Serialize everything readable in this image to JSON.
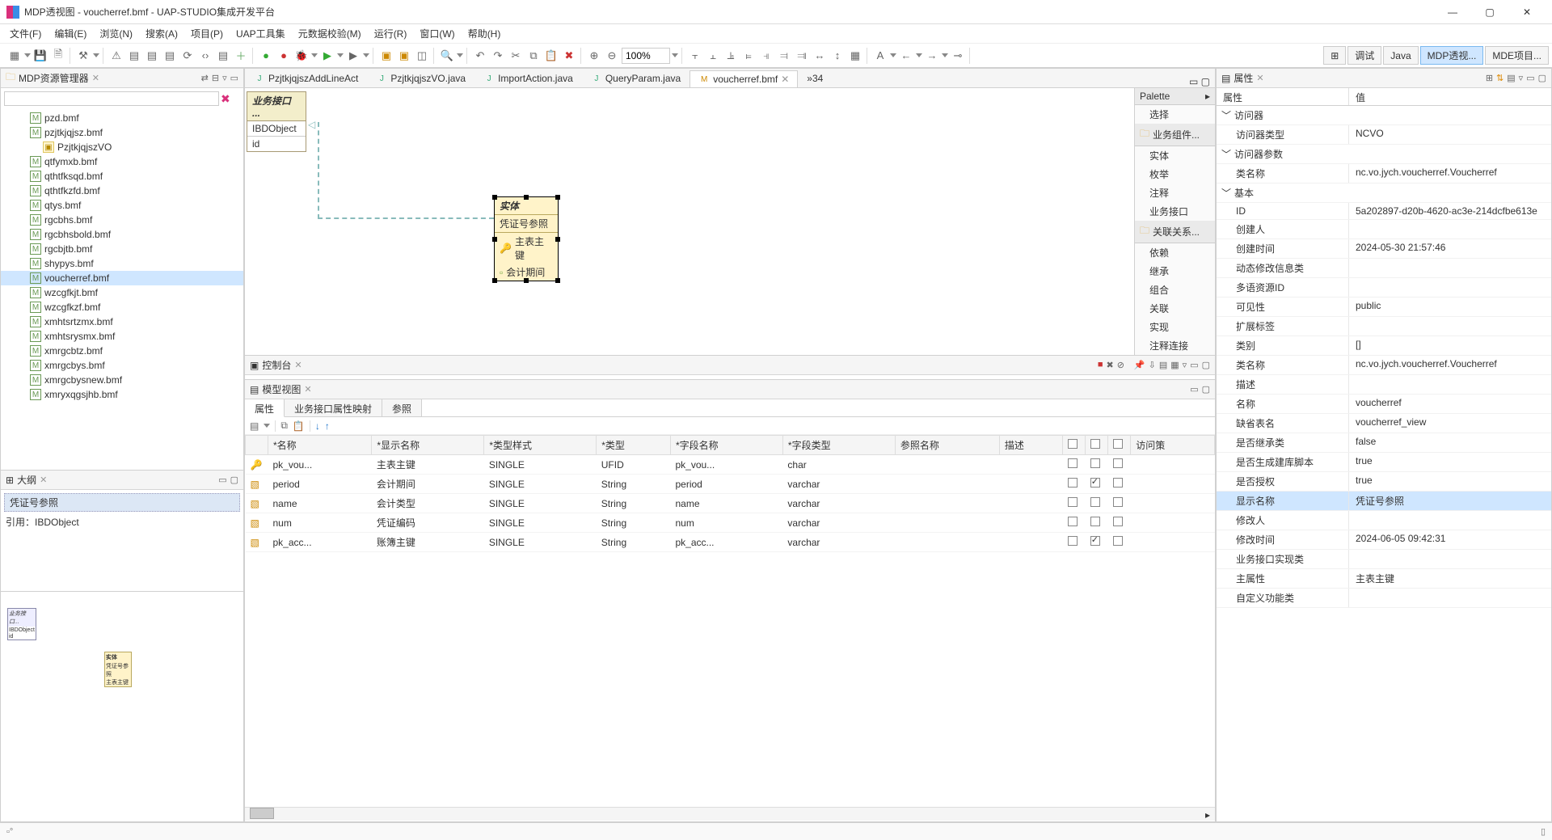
{
  "window": {
    "title": "MDP透视图 -  voucherref.bmf  -  UAP-STUDIO集成开发平台",
    "minimize": "—",
    "maximize": "▢",
    "close": "✕"
  },
  "menubar": [
    "文件(F)",
    "编辑(E)",
    "浏览(N)",
    "搜索(A)",
    "项目(P)",
    "UAP工具集",
    "元数据校验(M)",
    "运行(R)",
    "窗口(W)",
    "帮助(H)"
  ],
  "zoom": "100%",
  "perspectives": [
    {
      "label": "调试",
      "active": false
    },
    {
      "label": "Java",
      "active": false
    },
    {
      "label": "MDP透视...",
      "active": true
    },
    {
      "label": "MDE项目...",
      "active": false
    }
  ],
  "explorer": {
    "title": "MDP资源管理器",
    "items": [
      {
        "label": "pzd.bmf",
        "type": "m"
      },
      {
        "label": "pzjtkjqjsz.bmf",
        "type": "m"
      },
      {
        "label": "PzjtkjqjszVO",
        "type": "y",
        "indent": true
      },
      {
        "label": "qtfymxb.bmf",
        "type": "m"
      },
      {
        "label": "qthtfksqd.bmf",
        "type": "m"
      },
      {
        "label": "qthtfkzfd.bmf",
        "type": "m"
      },
      {
        "label": "qtys.bmf",
        "type": "m"
      },
      {
        "label": "rgcbhs.bmf",
        "type": "m"
      },
      {
        "label": "rgcbhsbold.bmf",
        "type": "m"
      },
      {
        "label": "rgcbjtb.bmf",
        "type": "m"
      },
      {
        "label": "shypys.bmf",
        "type": "m"
      },
      {
        "label": "voucherref.bmf",
        "type": "m",
        "selected": true
      },
      {
        "label": "wzcgfkjt.bmf",
        "type": "m"
      },
      {
        "label": "wzcgfkzf.bmf",
        "type": "m"
      },
      {
        "label": "xmhtsrtzmx.bmf",
        "type": "m"
      },
      {
        "label": "xmhtsrysmx.bmf",
        "type": "m"
      },
      {
        "label": "xmrgcbtz.bmf",
        "type": "m"
      },
      {
        "label": "xmrgcbys.bmf",
        "type": "m"
      },
      {
        "label": "xmrgcbysnew.bmf",
        "type": "m"
      },
      {
        "label": "xmryxqgsjhb.bmf",
        "type": "m"
      }
    ]
  },
  "outline": {
    "title": "大纲",
    "sel": "凭证号参照",
    "ref": "引用：IBDObject"
  },
  "editorTabs": [
    {
      "label": "PzjtkjqjszAddLineAct",
      "icon": "J"
    },
    {
      "label": "PzjtkjqjszVO.java",
      "icon": "J"
    },
    {
      "label": "ImportAction.java",
      "icon": "J"
    },
    {
      "label": "QueryParam.java",
      "icon": "J"
    },
    {
      "label": "voucherref.bmf",
      "icon": "M",
      "active": true
    }
  ],
  "editorMore": "»34",
  "diagram": {
    "intf": {
      "hdr": "业务接口 ...",
      "name": "IBDObject",
      "field": "id"
    },
    "entity": {
      "hdr": "实体",
      "title": "凭证号参照",
      "fields": [
        "主表主键",
        "会计期间"
      ]
    }
  },
  "palette": {
    "title": "Palette",
    "groups": [
      {
        "hdr": "",
        "items": [
          {
            "label": "选择"
          }
        ]
      },
      {
        "hdr": "业务组件...",
        "items": [
          {
            "label": "实体"
          },
          {
            "label": "枚举"
          },
          {
            "label": "注释"
          },
          {
            "label": "业务接口"
          }
        ]
      },
      {
        "hdr": "关联关系...",
        "items": [
          {
            "label": "依赖"
          },
          {
            "label": "继承"
          },
          {
            "label": "组合"
          },
          {
            "label": "关联"
          },
          {
            "label": "实现"
          },
          {
            "label": "注释连接"
          }
        ]
      }
    ]
  },
  "console": {
    "title": "控制台"
  },
  "modelView": {
    "title": "模型视图",
    "subtabs": [
      "属性",
      "业务接口属性映射",
      "参照"
    ],
    "columns": [
      "*名称",
      "*显示名称",
      "*类型样式",
      "*类型",
      "*字段名称",
      "*字段类型",
      "参照名称",
      "描述"
    ],
    "rows": [
      {
        "c": [
          "pk_vou...",
          "主表主键",
          "SINGLE",
          "UFID",
          "pk_vou...",
          "char",
          "",
          ""
        ],
        "k": [
          false,
          false,
          false
        ],
        "key": true
      },
      {
        "c": [
          "period",
          "会计期间",
          "SINGLE",
          "String",
          "period",
          "varchar",
          "",
          ""
        ],
        "k": [
          false,
          true,
          false
        ]
      },
      {
        "c": [
          "name",
          "会计类型",
          "SINGLE",
          "String",
          "name",
          "varchar",
          "",
          ""
        ],
        "k": [
          false,
          false,
          false
        ]
      },
      {
        "c": [
          "num",
          "凭证编码",
          "SINGLE",
          "String",
          "num",
          "varchar",
          "",
          ""
        ],
        "k": [
          false,
          false,
          false
        ]
      },
      {
        "c": [
          "pk_acc...",
          "账簿主键",
          "SINGLE",
          "String",
          "pk_acc...",
          "varchar",
          "",
          ""
        ],
        "k": [
          false,
          true,
          false
        ]
      }
    ],
    "trailLabel": "访问策"
  },
  "properties": {
    "title": "属性",
    "hdr": [
      "属性",
      "值"
    ],
    "groups": [
      {
        "name": "访问器",
        "rows": [
          [
            "访问器类型",
            "NCVO"
          ]
        ]
      },
      {
        "name": "访问器参数",
        "rows": [
          [
            "类名称",
            "nc.vo.jych.voucherref.Voucherref"
          ]
        ]
      },
      {
        "name": "基本",
        "rows": [
          [
            "ID",
            "5a202897-d20b-4620-ac3e-214dcfbe613e"
          ],
          [
            "创建人",
            ""
          ],
          [
            "创建时间",
            "2024-05-30 21:57:46"
          ],
          [
            "动态修改信息类",
            ""
          ],
          [
            "多语资源ID",
            ""
          ],
          [
            "可见性",
            "public"
          ],
          [
            "扩展标签",
            ""
          ],
          [
            "类别",
            "[]"
          ],
          [
            "类名称",
            "nc.vo.jych.voucherref.Voucherref"
          ],
          [
            "描述",
            ""
          ],
          [
            "名称",
            "voucherref"
          ],
          [
            "缺省表名",
            "voucherref_view"
          ],
          [
            "是否继承类",
            "false"
          ],
          [
            "是否生成建库脚本",
            "true"
          ],
          [
            "是否授权",
            "true"
          ],
          [
            "显示名称",
            "凭证号参照",
            true
          ],
          [
            "修改人",
            ""
          ],
          [
            "修改时间",
            "2024-06-05 09:42:31"
          ],
          [
            "业务接口实现类",
            ""
          ],
          [
            "主属性",
            "主表主键"
          ],
          [
            "自定义功能类",
            ""
          ]
        ]
      }
    ]
  }
}
